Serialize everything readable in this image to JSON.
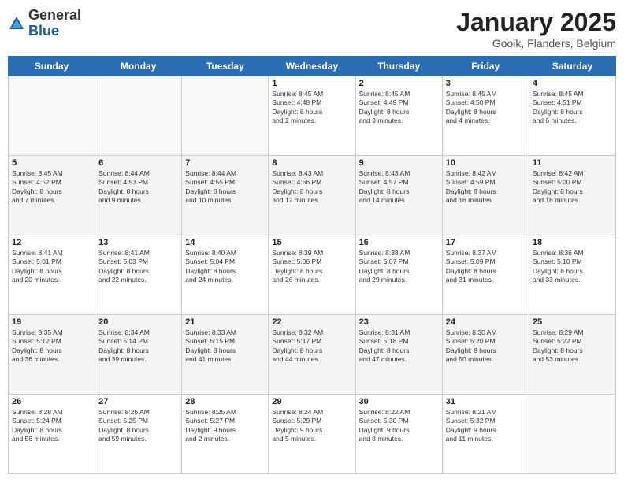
{
  "logo": {
    "general": "General",
    "blue": "Blue"
  },
  "title": "January 2025",
  "subtitle": "Gooik, Flanders, Belgium",
  "headers": [
    "Sunday",
    "Monday",
    "Tuesday",
    "Wednesday",
    "Thursday",
    "Friday",
    "Saturday"
  ],
  "weeks": [
    [
      {
        "day": "",
        "info": ""
      },
      {
        "day": "",
        "info": ""
      },
      {
        "day": "",
        "info": ""
      },
      {
        "day": "1",
        "info": "Sunrise: 8:45 AM\nSunset: 4:48 PM\nDaylight: 8 hours\nand 2 minutes."
      },
      {
        "day": "2",
        "info": "Sunrise: 8:45 AM\nSunset: 4:49 PM\nDaylight: 8 hours\nand 3 minutes."
      },
      {
        "day": "3",
        "info": "Sunrise: 8:45 AM\nSunset: 4:50 PM\nDaylight: 8 hours\nand 4 minutes."
      },
      {
        "day": "4",
        "info": "Sunrise: 8:45 AM\nSunset: 4:51 PM\nDaylight: 8 hours\nand 6 minutes."
      }
    ],
    [
      {
        "day": "5",
        "info": "Sunrise: 8:45 AM\nSunset: 4:52 PM\nDaylight: 8 hours\nand 7 minutes."
      },
      {
        "day": "6",
        "info": "Sunrise: 8:44 AM\nSunset: 4:53 PM\nDaylight: 8 hours\nand 9 minutes."
      },
      {
        "day": "7",
        "info": "Sunrise: 8:44 AM\nSunset: 4:55 PM\nDaylight: 8 hours\nand 10 minutes."
      },
      {
        "day": "8",
        "info": "Sunrise: 8:43 AM\nSunset: 4:56 PM\nDaylight: 8 hours\nand 12 minutes."
      },
      {
        "day": "9",
        "info": "Sunrise: 8:43 AM\nSunset: 4:57 PM\nDaylight: 8 hours\nand 14 minutes."
      },
      {
        "day": "10",
        "info": "Sunrise: 8:42 AM\nSunset: 4:59 PM\nDaylight: 8 hours\nand 16 minutes."
      },
      {
        "day": "11",
        "info": "Sunrise: 8:42 AM\nSunset: 5:00 PM\nDaylight: 8 hours\nand 18 minutes."
      }
    ],
    [
      {
        "day": "12",
        "info": "Sunrise: 8:41 AM\nSunset: 5:01 PM\nDaylight: 8 hours\nand 20 minutes."
      },
      {
        "day": "13",
        "info": "Sunrise: 8:41 AM\nSunset: 5:03 PM\nDaylight: 8 hours\nand 22 minutes."
      },
      {
        "day": "14",
        "info": "Sunrise: 8:40 AM\nSunset: 5:04 PM\nDaylight: 8 hours\nand 24 minutes."
      },
      {
        "day": "15",
        "info": "Sunrise: 8:39 AM\nSunset: 5:06 PM\nDaylight: 8 hours\nand 26 minutes."
      },
      {
        "day": "16",
        "info": "Sunrise: 8:38 AM\nSunset: 5:07 PM\nDaylight: 8 hours\nand 29 minutes."
      },
      {
        "day": "17",
        "info": "Sunrise: 8:37 AM\nSunset: 5:09 PM\nDaylight: 8 hours\nand 31 minutes."
      },
      {
        "day": "18",
        "info": "Sunrise: 8:36 AM\nSunset: 5:10 PM\nDaylight: 8 hours\nand 33 minutes."
      }
    ],
    [
      {
        "day": "19",
        "info": "Sunrise: 8:35 AM\nSunset: 5:12 PM\nDaylight: 8 hours\nand 36 minutes."
      },
      {
        "day": "20",
        "info": "Sunrise: 8:34 AM\nSunset: 5:14 PM\nDaylight: 8 hours\nand 39 minutes."
      },
      {
        "day": "21",
        "info": "Sunrise: 8:33 AM\nSunset: 5:15 PM\nDaylight: 8 hours\nand 41 minutes."
      },
      {
        "day": "22",
        "info": "Sunrise: 8:32 AM\nSunset: 5:17 PM\nDaylight: 8 hours\nand 44 minutes."
      },
      {
        "day": "23",
        "info": "Sunrise: 8:31 AM\nSunset: 5:18 PM\nDaylight: 8 hours\nand 47 minutes."
      },
      {
        "day": "24",
        "info": "Sunrise: 8:30 AM\nSunset: 5:20 PM\nDaylight: 8 hours\nand 50 minutes."
      },
      {
        "day": "25",
        "info": "Sunrise: 8:29 AM\nSunset: 5:22 PM\nDaylight: 8 hours\nand 53 minutes."
      }
    ],
    [
      {
        "day": "26",
        "info": "Sunrise: 8:28 AM\nSunset: 5:24 PM\nDaylight: 8 hours\nand 56 minutes."
      },
      {
        "day": "27",
        "info": "Sunrise: 8:26 AM\nSunset: 5:25 PM\nDaylight: 8 hours\nand 59 minutes."
      },
      {
        "day": "28",
        "info": "Sunrise: 8:25 AM\nSunset: 5:27 PM\nDaylight: 9 hours\nand 2 minutes."
      },
      {
        "day": "29",
        "info": "Sunrise: 8:24 AM\nSunset: 5:29 PM\nDaylight: 9 hours\nand 5 minutes."
      },
      {
        "day": "30",
        "info": "Sunrise: 8:22 AM\nSunset: 5:30 PM\nDaylight: 9 hours\nand 8 minutes."
      },
      {
        "day": "31",
        "info": "Sunrise: 8:21 AM\nSunset: 5:32 PM\nDaylight: 9 hours\nand 11 minutes."
      },
      {
        "day": "",
        "info": ""
      }
    ]
  ]
}
